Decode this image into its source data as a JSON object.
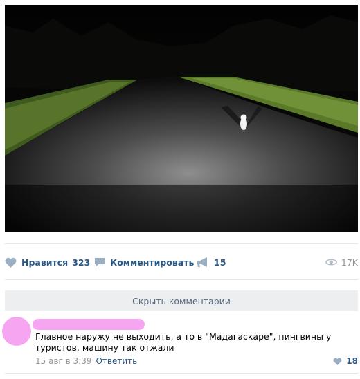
{
  "post": {
    "actions": {
      "like_label": "Нравится",
      "like_count": "323",
      "comment_label": "Комментировать",
      "share_count": "15",
      "views_count": "17K"
    }
  },
  "comments": {
    "hide_label": "Скрыть комментарии",
    "items": [
      {
        "text": "Главное наружу не выходить, а то в \"Мадагаскаре\", пингвины у туристов, машину так отжали",
        "date": "15 авг в 3:39",
        "reply_label": "Ответить",
        "likes": "18"
      }
    ]
  },
  "colors": {
    "link": "#2a5885",
    "muted": "#939393",
    "redaction": "#f6a6f1",
    "hide_bar_bg": "#edeef0"
  },
  "icons": [
    "heart-icon",
    "comment-icon",
    "megaphone-icon",
    "eye-icon"
  ]
}
